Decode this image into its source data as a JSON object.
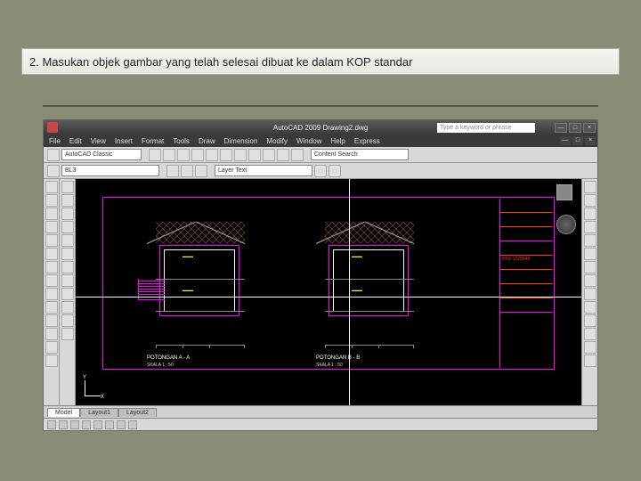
{
  "instruction": "2. Masukan objek gambar yang telah selesai dibuat ke dalam KOP standar",
  "app": {
    "title": "AutoCAD 2009 Drawing2.dwg",
    "search_placeholder": "Type a keyword or phrase"
  },
  "menu": {
    "items": [
      "File",
      "Edit",
      "View",
      "Insert",
      "Format",
      "Tools",
      "Draw",
      "Dimension",
      "Modify",
      "Window",
      "Help",
      "Express"
    ]
  },
  "workspace": {
    "selected": "AutoCAD Classic"
  },
  "layer": {
    "selected": "BL3"
  },
  "content_search": {
    "placeholder": "Content Search"
  },
  "layer_text": {
    "label": "Layer Text"
  },
  "tabs": {
    "items": [
      "Model",
      "Layout1",
      "Layout2"
    ],
    "active": 0
  },
  "sections": {
    "a": {
      "label": "POTONGAN A - A",
      "scale": "SKALA 1 : 50"
    },
    "b": {
      "label": "POTONGAN B - B",
      "scale": "SKALA 1 : 50"
    }
  },
  "titleblock": {
    "rows": [
      "",
      "",
      "",
      "",
      "KPU 1220040",
      "",
      "",
      ""
    ]
  },
  "ucs": {
    "x": "X",
    "y": "Y"
  },
  "win_controls": {
    "min": "—",
    "max": "□",
    "close": "×"
  }
}
